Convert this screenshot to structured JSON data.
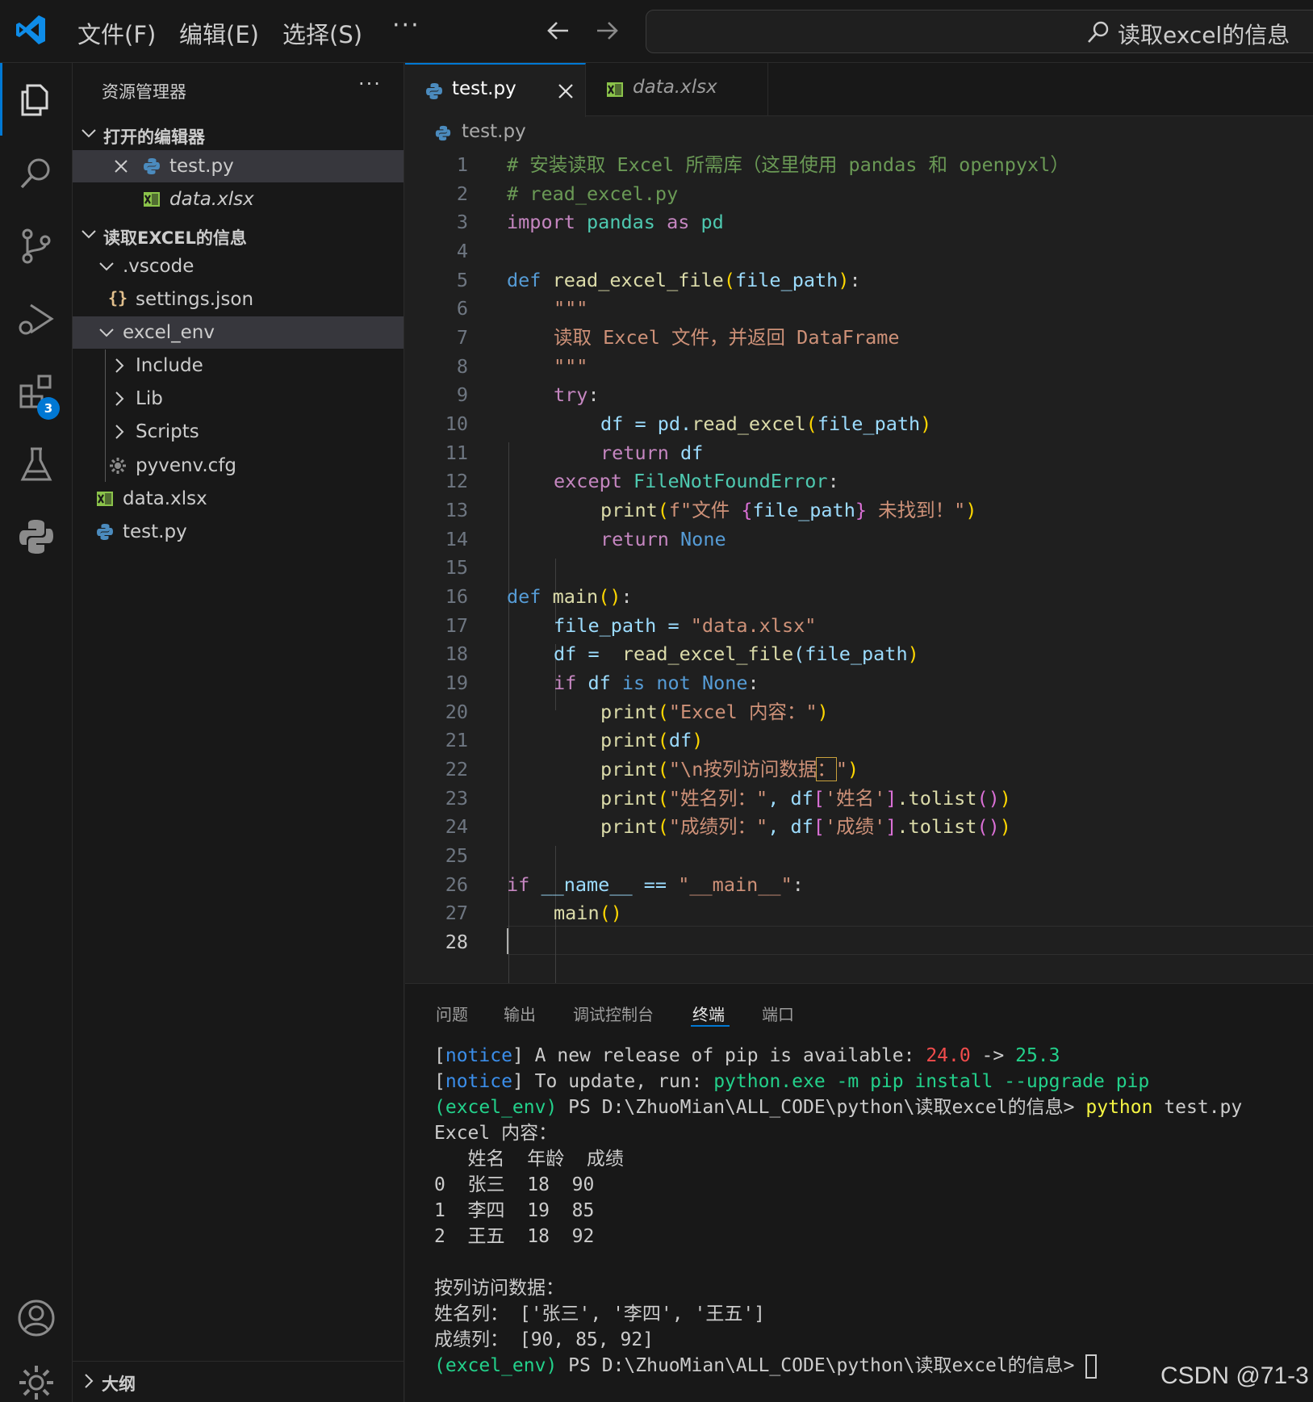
{
  "titlebar": {
    "menus": [
      "文件(F)",
      "编辑(E)",
      "选择(S)"
    ],
    "more": "···",
    "search_text": "读取excel的信息"
  },
  "activitybar": {
    "extensions_badge": "3"
  },
  "sidebar": {
    "title": "资源管理器",
    "more": "···",
    "open_editors_header": "打开的编辑器",
    "open_editors": [
      "test.py",
      "data.xlsx"
    ],
    "folder_header": "读取EXCEL的信息",
    "tree": {
      "vscode": ".vscode",
      "settings": "settings.json",
      "excel_env": "excel_env",
      "include": "Include",
      "lib": "Lib",
      "scripts": "Scripts",
      "pyvenv": "pyvenv.cfg",
      "data": "data.xlsx",
      "test": "test.py"
    },
    "outline_header": "大纲"
  },
  "tabs": [
    {
      "label": "test.py"
    },
    {
      "label": "data.xlsx"
    }
  ],
  "breadcrumb": "test.py",
  "editor": {
    "line_numbers": [
      "1",
      "2",
      "3",
      "4",
      "5",
      "6",
      "7",
      "8",
      "9",
      "10",
      "11",
      "12",
      "13",
      "14",
      "15",
      "16",
      "17",
      "18",
      "19",
      "20",
      "21",
      "22",
      "23",
      "24",
      "25",
      "26",
      "27",
      "28"
    ],
    "code": {
      "l1": "# 安装读取 Excel 所需库（这里使用 pandas 和 openpyxl）",
      "l2": "# read_excel.py",
      "import": "import",
      "pandas": " pandas ",
      "as": "as",
      "pd": " pd",
      "def": "def",
      "read_excel_file": " read_excel_file",
      "file_path": "file_path",
      "docq": "\"\"\"",
      "doc": "读取 Excel 文件，并返回 DataFrame",
      "try": "try",
      "l10a": "df = pd.",
      "read_excel": "read_excel",
      "return": "return",
      "df": " df",
      "except": "except",
      "fnf": " FileNotFoundError",
      "print": "print",
      "fstr_a": "f\"文件 ",
      "fstr_b": "file_path",
      "fstr_c": " 未找到！\"",
      "none": " None",
      "main": " main",
      "l17a": "file_path = ",
      "l17b": "\"data.xlsx\"",
      "l18a": "df = ",
      "l18b": "(file_path",
      "if": "if",
      "is": "is",
      "not": "not",
      "s20": "\"Excel 内容：\"",
      "s22a": "\"\\n按列访问数据",
      "s22b": "：",
      "s22c": "\"",
      "s23a": "\"姓名列：\"",
      "s23b": ", df",
      "s23c": "'姓名'",
      "tolist": ".tolist",
      "s24a": "\"成绩列：\"",
      "s24c": "'成绩'",
      "l26a": " __name__ == ",
      "l26b": "\"__main__\"",
      "main_call": "main"
    }
  },
  "panel": {
    "tabs": [
      "问题",
      "输出",
      "调试控制台",
      "终端",
      "端口"
    ],
    "active_tab": "终端",
    "terminal": {
      "notice": "notice",
      "l1a": "] A new release of pip is available: ",
      "l1b": "24.0",
      "l1c": " -> ",
      "l1d": "25.3",
      "l2a": "] To update, run: ",
      "l2b": "python.exe -m pip install --upgrade pip",
      "env": "(excel_env)",
      "prompt": " PS D:\\ZhuoMian\\ALL_CODE\\python\\读取excel的信息> ",
      "cmd_python": "python",
      "cmd_arg": " test.py",
      "out1": "Excel 内容：",
      "out2": "   姓名  年龄  成绩",
      "out3": "0  张三  18  90",
      "out4": "1  李四  19  85",
      "out5": "2  王五  18  92",
      "out6": "按列访问数据：",
      "out7": "姓名列： ['张三', '李四', '王五']",
      "out8": "成绩列： [90, 85, 92]"
    }
  },
  "watermark": "CSDN @71-3",
  "colors": {
    "accent": "#0078d4",
    "background": "#1f1f1f",
    "sidebar": "#181818",
    "selection": "#37373d"
  }
}
